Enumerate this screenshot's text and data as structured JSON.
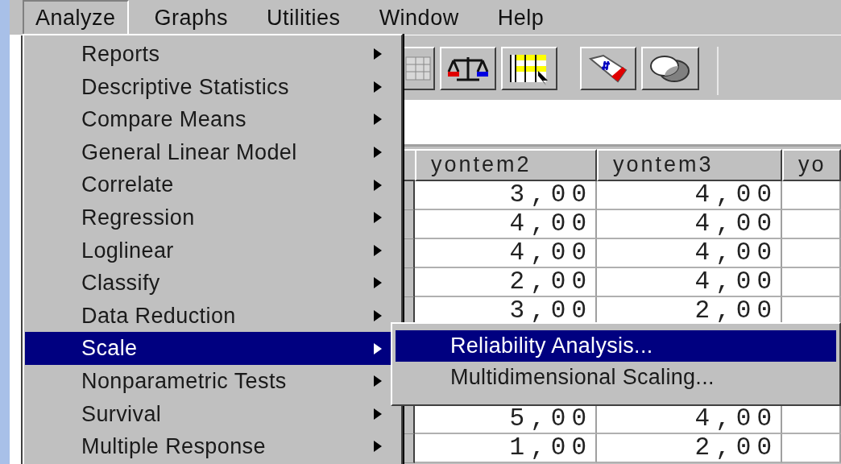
{
  "menubar": [
    {
      "label": "Analyze",
      "selected": true
    },
    {
      "label": "Graphs",
      "selected": false
    },
    {
      "label": "Utilities",
      "selected": false
    },
    {
      "label": "Window",
      "selected": false
    },
    {
      "label": "Help",
      "selected": false
    }
  ],
  "analyze_menu": [
    {
      "label": "Reports",
      "has_submenu": true,
      "selected": false
    },
    {
      "label": "Descriptive Statistics",
      "has_submenu": true,
      "selected": false
    },
    {
      "label": "Compare Means",
      "has_submenu": true,
      "selected": false
    },
    {
      "label": "General Linear Model",
      "has_submenu": true,
      "selected": false
    },
    {
      "label": "Correlate",
      "has_submenu": true,
      "selected": false
    },
    {
      "label": "Regression",
      "has_submenu": true,
      "selected": false
    },
    {
      "label": "Loglinear",
      "has_submenu": true,
      "selected": false
    },
    {
      "label": "Classify",
      "has_submenu": true,
      "selected": false
    },
    {
      "label": "Data Reduction",
      "has_submenu": true,
      "selected": false
    },
    {
      "label": "Scale",
      "has_submenu": true,
      "selected": true
    },
    {
      "label": "Nonparametric Tests",
      "has_submenu": true,
      "selected": false
    },
    {
      "label": "Survival",
      "has_submenu": true,
      "selected": false
    },
    {
      "label": "Multiple Response",
      "has_submenu": true,
      "selected": false
    }
  ],
  "scale_submenu": [
    {
      "label": "Reliability Analysis...",
      "selected": true
    },
    {
      "label": "Multidimensional Scaling...",
      "selected": false
    }
  ],
  "table": {
    "columns": [
      "yontem2",
      "yontem3",
      "yo"
    ],
    "row_groups": [
      {
        "rows": [
          [
            "3,00",
            "4,00"
          ],
          [
            "4,00",
            "4,00"
          ],
          [
            "4,00",
            "4,00"
          ],
          [
            "2,00",
            "4,00"
          ],
          [
            "3,00",
            "2,00"
          ]
        ]
      },
      {
        "rows": [
          [
            "5,00",
            "4,00"
          ],
          [
            "1,00",
            "2,00"
          ]
        ]
      }
    ]
  }
}
